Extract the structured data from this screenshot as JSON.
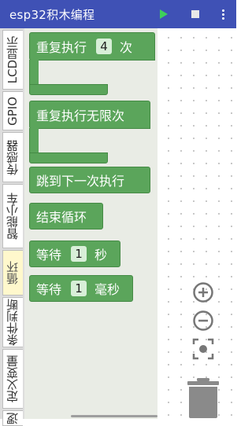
{
  "app": {
    "title": "esp32积木编程"
  },
  "toolbar": {
    "run_icon": "play-icon",
    "stop_icon": "stop-icon",
    "menu_icon": "more-vert-icon"
  },
  "categories": [
    {
      "label": "LCD显示",
      "active": false
    },
    {
      "label": "GPIO",
      "active": false
    },
    {
      "label": "传感器",
      "active": false
    },
    {
      "label": "智能小车",
      "active": false
    },
    {
      "label": "循环",
      "active": true
    },
    {
      "label": "条件判断",
      "active": false
    },
    {
      "label": "定义变量",
      "active": false
    },
    {
      "label": "逻",
      "active": false
    }
  ],
  "blocks": {
    "repeat_times": {
      "label": "重复执行",
      "value": "4",
      "suffix": "次"
    },
    "repeat_forever": {
      "label": "重复执行无限次"
    },
    "continue": {
      "label": "跳到下一次执行"
    },
    "break": {
      "label": "结束循环"
    },
    "wait_seconds": {
      "label": "等待",
      "value": "1",
      "suffix": "秒"
    },
    "wait_ms": {
      "label": "等待",
      "value": "1",
      "suffix": "毫秒"
    }
  },
  "colors": {
    "appbar": "#3f51b5",
    "block": "#5ba55b",
    "flyout": "#e9ece5",
    "active_tab": "#fff8cc",
    "run": "#3ecf5a"
  },
  "workspace_controls": [
    "zoom-in-icon",
    "zoom-out-icon",
    "recenter-icon",
    "trash-icon"
  ]
}
